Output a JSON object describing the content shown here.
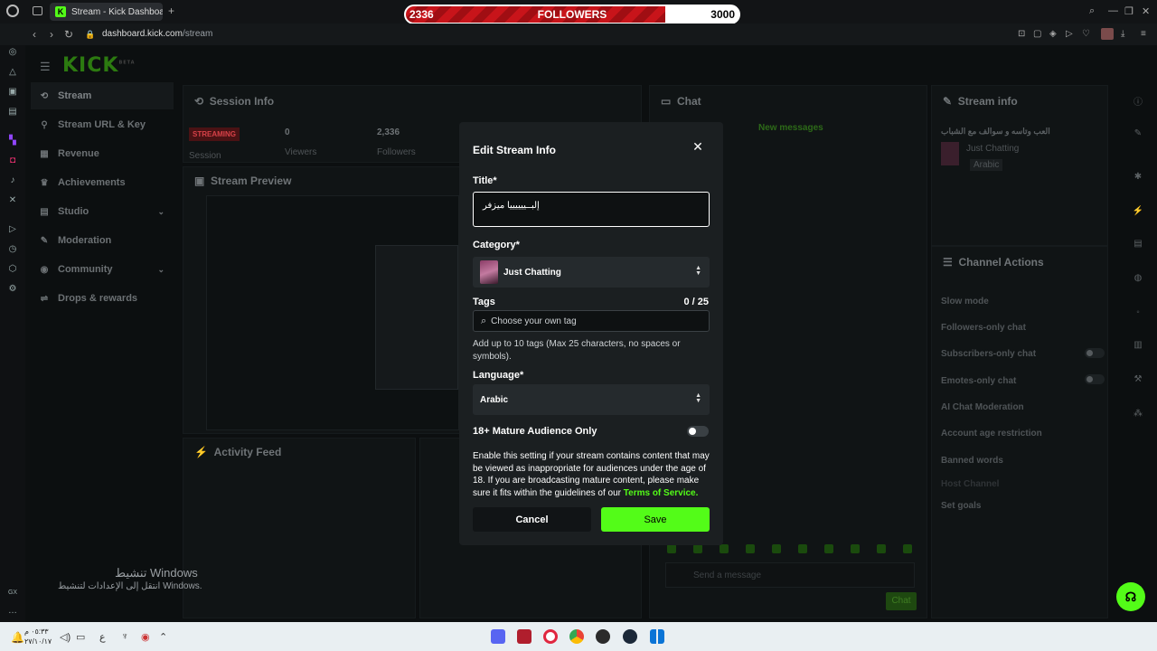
{
  "browser": {
    "tab_title": "Stream - Kick Dashboard",
    "tab_favicon": "K",
    "url_host": "dashboard.kick.com",
    "url_path": "/stream"
  },
  "follower_goal": {
    "current": "2336",
    "label": "FOLLOWERS",
    "target": "3000",
    "progress_fraction": 0.7787,
    "fill_color": "#c8141a"
  },
  "dashboard": {
    "logo": "KICK",
    "logo_sup": "BETA",
    "nav": [
      {
        "label": "Stream",
        "icon": "stream-icon",
        "active": true
      },
      {
        "label": "Stream URL & Key",
        "icon": "key-icon"
      },
      {
        "label": "Revenue",
        "icon": "revenue-icon"
      },
      {
        "label": "Achievements",
        "icon": "trophy-icon"
      },
      {
        "label": "Studio",
        "icon": "studio-icon",
        "has_children": true
      },
      {
        "label": "Moderation",
        "icon": "moderation-icon"
      },
      {
        "label": "Community",
        "icon": "community-icon",
        "has_children": true
      },
      {
        "label": "Drops & rewards",
        "icon": "drops-icon"
      }
    ],
    "session_info": {
      "title": "Session Info",
      "status_badge": "STREAMING",
      "session_label": "Session",
      "viewers_value": "0",
      "viewers_label": "Viewers",
      "followers_value": "2,336",
      "followers_label": "Followers"
    },
    "stream_preview_title": "Stream Preview",
    "activity_feed_title": "Activity Feed",
    "chat": {
      "title": "Chat",
      "new_messages": "New messages",
      "send_placeholder": "Send a message",
      "send_button": "Chat"
    },
    "stream_info": {
      "title": "Stream info",
      "stream_title": "العب وتاسه و سوالف مع الشباب",
      "category": "Just Chatting",
      "language": "Arabic"
    },
    "channel_actions": {
      "title": "Channel Actions",
      "items": [
        "Slow mode",
        "Followers-only chat",
        "Subscribers-only chat",
        "Emotes-only chat",
        "AI Chat Moderation",
        "Account age restriction",
        "Banned words",
        "Host Channel",
        "Set goals"
      ]
    }
  },
  "modal": {
    "title": "Edit Stream Info",
    "title_label": "Title*",
    "title_value": "إلبــييييييا ميزفر",
    "category_label": "Category*",
    "category_value": "Just Chatting",
    "tags_label": "Tags",
    "tags_count": "0 / 25",
    "tags_placeholder": "Choose your own tag",
    "tags_help": "Add up to 10 tags (Max 25 characters, no spaces or symbols).",
    "language_label": "Language*",
    "language_value": "Arabic",
    "mature_label": "18+ Mature Audience Only",
    "mature_enabled": false,
    "mature_help": "Enable this setting if your stream contains content that may be viewed as inappropriate for audiences under the age of 18. If you are broadcasting mature content, please make sure it fits within the guidelines of our",
    "tos_link": "Terms of Service.",
    "cancel_label": "Cancel",
    "save_label": "Save",
    "accent_color": "#53fc18"
  },
  "windows_activation": {
    "line1": "تنشيط Windows",
    "line2": "انتقل إلى الإعدادات لتنشيط Windows."
  },
  "taskbar": {
    "time": "٠٥:٣٣ م",
    "date": "٢٧/١٠/١٧"
  }
}
